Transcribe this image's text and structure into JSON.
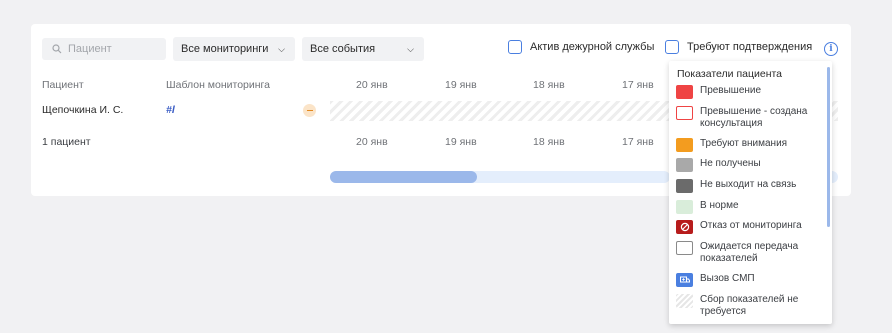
{
  "toolbar": {
    "search_placeholder": "Пациент",
    "monitoring_select": "Все мониторинги",
    "events_select": "Все события",
    "duty_checkbox_label": "Актив дежурной службы",
    "confirm_checkbox_label": "Требуют подтверждения",
    "info_icon_glyph": "i"
  },
  "table": {
    "columns": {
      "patient": "Пациент",
      "template": "Шаблон мониторинга"
    },
    "dates": [
      "20 янв",
      "19 янв",
      "18 янв",
      "17 янв"
    ],
    "rows": [
      {
        "name": "Щепочкина И. С.",
        "template": "#l"
      }
    ],
    "footer": {
      "count": "1 пациент",
      "dates": [
        "20 янв",
        "19 янв",
        "18 янв",
        "17 янв"
      ]
    }
  },
  "legend": {
    "title": "Показатели пациента",
    "items": [
      {
        "label": "Превышение",
        "icon": "red-square",
        "color": "#ef4444"
      },
      {
        "label": "Превышение - создана консультация",
        "icon": "red-outline-square",
        "color": "#ef4444"
      },
      {
        "label": "Требуют внимания",
        "icon": "orange-square",
        "color": "#f39c1f"
      },
      {
        "label": "Не получены",
        "icon": "gray-square",
        "color": "#a9a9a9"
      },
      {
        "label": "Не выходит на связь",
        "icon": "dark-gray-square",
        "color": "#6b6b6b"
      },
      {
        "label": "В норме",
        "icon": "light-green-square",
        "color": "#d9edda"
      },
      {
        "label": "Отказ от мониторинга",
        "icon": "refusal-icon",
        "color": "#b71c1c"
      },
      {
        "label": "Ожидается передача показателей",
        "icon": "empty-square",
        "color": "#ffffff"
      },
      {
        "label": "Вызов СМП",
        "icon": "ambulance-icon",
        "color": "#4a7fe0"
      },
      {
        "label": "Сбор показателей не требуется",
        "icon": "hatched-square",
        "color": "#eeeeee"
      }
    ]
  },
  "scroll": {
    "horizontal_position": 0.43
  }
}
